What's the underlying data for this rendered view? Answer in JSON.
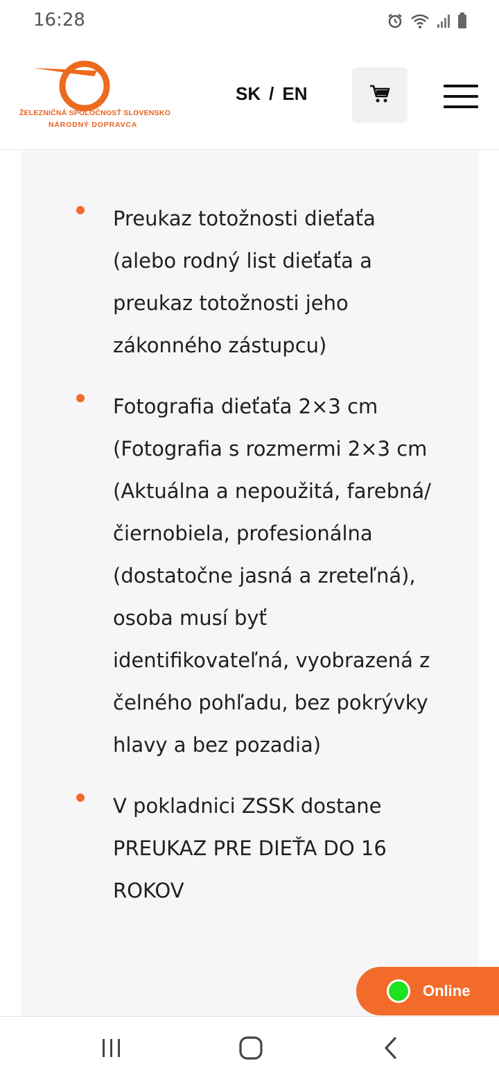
{
  "status_bar": {
    "time": "16:28",
    "icons": [
      "alarm-icon",
      "wifi-icon",
      "signal-icon",
      "battery-icon"
    ]
  },
  "header": {
    "logo": {
      "line1": "ŽELEZNIČNÁ SPOLOČNOSŤ SLOVENSKO",
      "line2": "NÁRODNÝ DOPRAVCA"
    },
    "lang": {
      "sk": "SK",
      "separator": "/",
      "en": "EN"
    },
    "cart_icon": "cart-icon",
    "menu_icon": "hamburger-menu-icon"
  },
  "content": {
    "items": [
      {
        "text": "Preukaz totožnosti dieťaťa (alebo rodný list dieťaťa a preukaz totožnosti jeho zákonného zástupcu)"
      },
      {
        "text": "Fotografia dieťaťa 2×3 cm (Fotografia s rozmermi 2×3 cm (Aktuálna a nepoužitá, farebná/čiernobiela, profesionálna (dostatočne jasná a zreteľná), osoba musí byť identifikovateľná, vyobrazená z čelného pohľadu, bez pokrývky hlavy a bez pozadia)"
      },
      {
        "text": "V pokladnici ZSSK dostane PREUKAZ PRE DIEŤA DO 16 ROKOV"
      }
    ]
  },
  "chat": {
    "label": "Online",
    "status_color": "#1ee21e"
  },
  "navbar": {
    "icons": [
      "recent-apps-icon",
      "home-icon",
      "back-icon"
    ]
  },
  "colors": {
    "accent": "#f26b2a",
    "logo": "#e8601c",
    "content_bg": "#f6f6f8"
  }
}
